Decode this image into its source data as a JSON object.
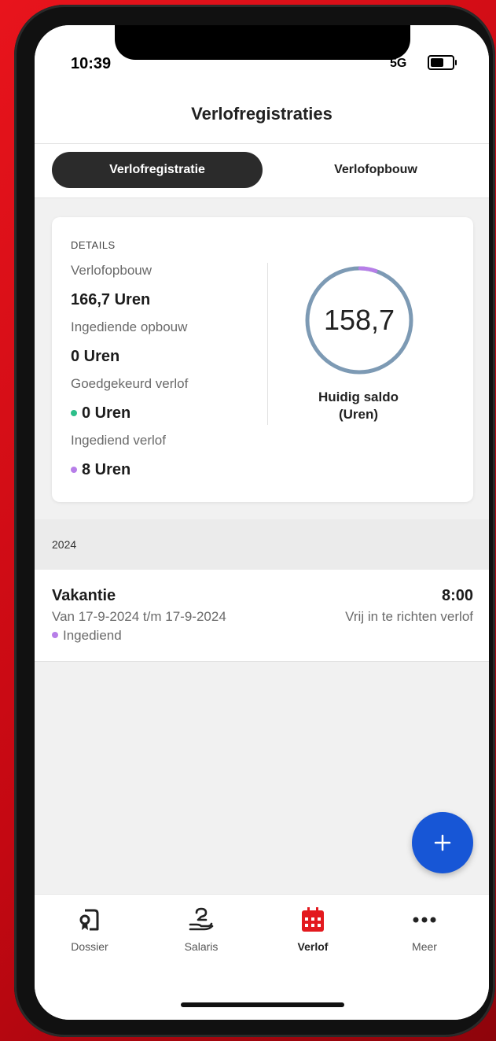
{
  "status_bar": {
    "time": "10:39",
    "network": "5G"
  },
  "header": {
    "title": "Verlofregistraties"
  },
  "tabs": [
    {
      "label": "Verlofregistratie",
      "active": true
    },
    {
      "label": "Verlofopbouw",
      "active": false
    }
  ],
  "details": {
    "section_label": "DETAILS",
    "rows": [
      {
        "label": "Verlofopbouw",
        "value": "166,7 Uren"
      },
      {
        "label": "Ingediende opbouw",
        "value": "0 Uren"
      },
      {
        "label": "Goedgekeurd verlof",
        "value": "0 Uren",
        "dot_color": "#2dbf8a"
      },
      {
        "label": "Ingediend verlof",
        "value": "8 Uren",
        "dot_color": "#b77ee8"
      }
    ],
    "balance": {
      "value": "158,7",
      "caption_line1": "Huidig saldo",
      "caption_line2": "(Uren)",
      "ring_color": "#7d9ab4",
      "submitted_color": "#b77ee8",
      "submitted_fraction": 0.048
    }
  },
  "year_section": {
    "label": "2024"
  },
  "entries": [
    {
      "title": "Vakantie",
      "hours": "8:00",
      "range": "Van 17-9-2024 t/m 17-9-2024",
      "type": "Vrij in te richten verlof",
      "status": "Ingediend",
      "status_color": "#b77ee8"
    }
  ],
  "fab": {
    "icon": "plus-icon",
    "color": "#1756d6"
  },
  "bottom_nav": [
    {
      "label": "Dossier",
      "icon": "dossier-icon",
      "active": false
    },
    {
      "label": "Salaris",
      "icon": "salary-hand-icon",
      "active": false
    },
    {
      "label": "Verlof",
      "icon": "calendar-icon",
      "active": true,
      "active_color": "#e3191e"
    },
    {
      "label": "Meer",
      "icon": "more-dots-icon",
      "active": false
    }
  ]
}
